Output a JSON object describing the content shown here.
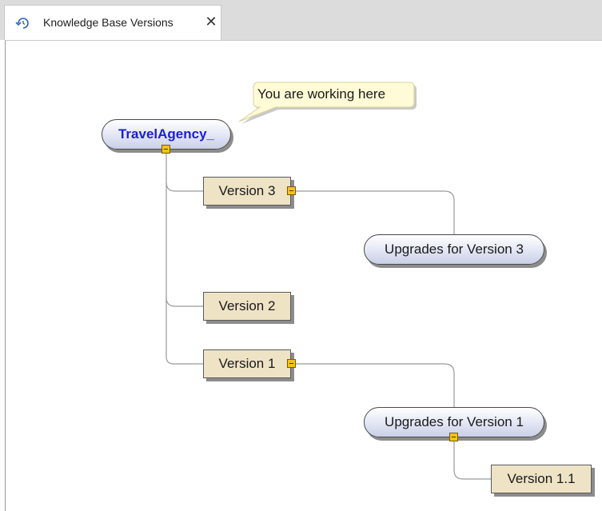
{
  "tab": {
    "icon": "history-icon",
    "title": "Knowledge Base Versions",
    "close_icon": "close-icon",
    "close_glyph": "✕"
  },
  "callout": {
    "text": "You are working here"
  },
  "tree": {
    "root": {
      "label": "TravelAgency_"
    },
    "version3": {
      "label": "Version 3"
    },
    "upgrades_v3": {
      "label": "Upgrades for Version 3"
    },
    "version2": {
      "label": "Version 2"
    },
    "version1": {
      "label": "Version 1"
    },
    "upgrades_v1": {
      "label": "Upgrades for Version 1"
    },
    "version1_1": {
      "label": "Version 1.1"
    }
  },
  "colors": {
    "root_text": "#1d1dd6",
    "version_box": "#efe3c6",
    "toggle": "#f4c21b",
    "callout": "#fffbd6"
  }
}
